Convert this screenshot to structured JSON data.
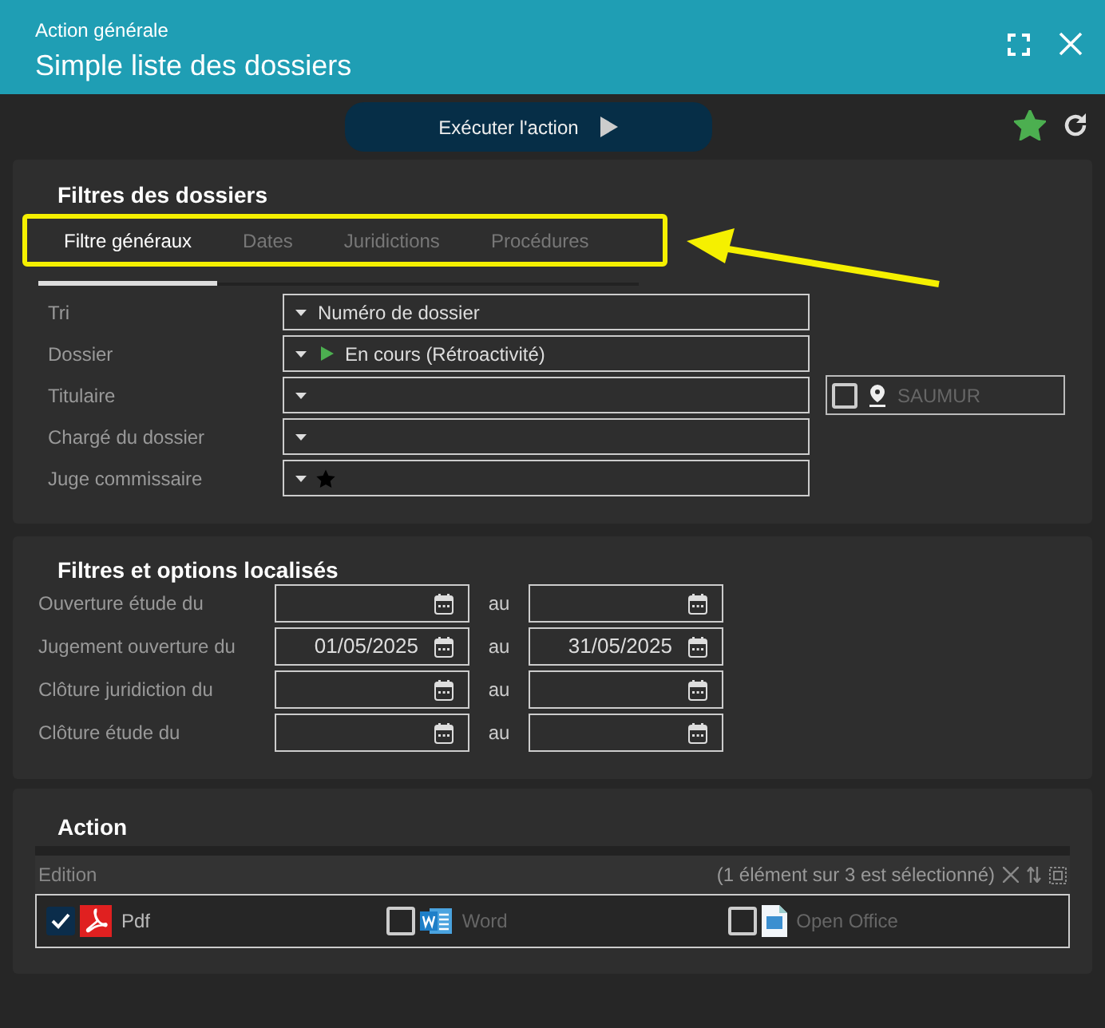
{
  "window": {
    "subtitle": "Action générale",
    "title": "Simple liste des dossiers"
  },
  "toolbar": {
    "run_button": "Exécuter l'action",
    "favorite": true
  },
  "filters": {
    "title": "Filtres des dossiers",
    "tabs": [
      {
        "label": "Filtre généraux",
        "selected": true
      },
      {
        "label": "Dates",
        "selected": false
      },
      {
        "label": "Juridictions",
        "selected": false
      },
      {
        "label": "Procédures",
        "selected": false
      }
    ],
    "fields": [
      {
        "label": "Tri",
        "value": "Numéro de dossier",
        "kind": "plain"
      },
      {
        "label": "Dossier",
        "value": "En cours (Rétroactivité)",
        "kind": "status"
      },
      {
        "label": "Titulaire",
        "kind": "plain",
        "location": {
          "checked": false,
          "placeholder": "SAUMUR"
        }
      },
      {
        "label": "Chargé du dossier",
        "kind": "plain"
      },
      {
        "label": "Juge commissaire",
        "kind": "starred"
      }
    ]
  },
  "localized": {
    "title": "Filtres et options localisés",
    "ranges": [
      {
        "label": "Ouverture étude du",
        "separator": "au"
      },
      {
        "label": "Jugement ouverture du",
        "from": "01/05/2025",
        "separator": "au",
        "to": "31/05/2025"
      },
      {
        "label": "Clôture juridiction du",
        "separator": "au"
      },
      {
        "label": "Clôture étude du",
        "separator": "au"
      }
    ]
  },
  "action": {
    "title": "Action",
    "list_label": "Edition",
    "summary": "(1 élément sur 3 est sélectionné)",
    "options": [
      {
        "label": "Pdf",
        "kind": "pdf",
        "checked": true
      },
      {
        "label": "Word",
        "kind": "word",
        "checked": false
      },
      {
        "label": "Open Office",
        "kind": "office",
        "checked": false
      }
    ]
  }
}
